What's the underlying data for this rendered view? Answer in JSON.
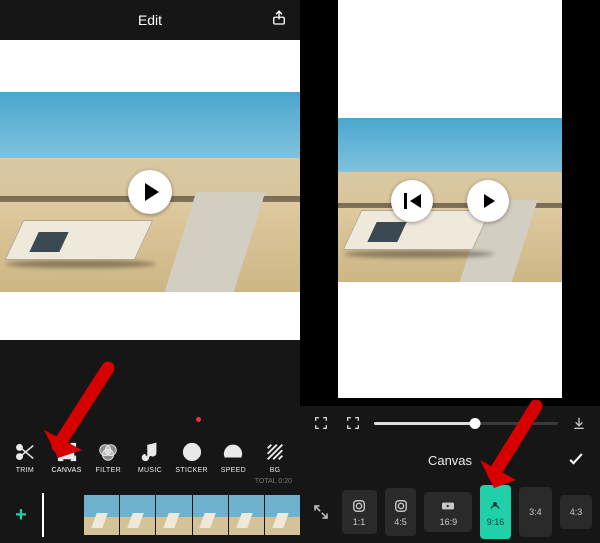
{
  "left": {
    "header": {
      "title": "Edit"
    },
    "tools": [
      {
        "id": "trim",
        "label": "TRIM"
      },
      {
        "id": "canvas",
        "label": "CANVAS"
      },
      {
        "id": "filter",
        "label": "FILTER"
      },
      {
        "id": "music",
        "label": "MUSIC"
      },
      {
        "id": "sticker",
        "label": "STICKER",
        "dot": true
      },
      {
        "id": "speed",
        "label": "SPEED"
      },
      {
        "id": "bg",
        "label": "BG"
      }
    ],
    "timeline_total": "TOTAL 0:20",
    "plus": "+"
  },
  "right": {
    "panel_title": "Canvas",
    "scrub_progress_pct": 55,
    "ratios": [
      {
        "id": "1_1",
        "label": "1:1"
      },
      {
        "id": "4_5",
        "label": "4:5"
      },
      {
        "id": "16_9",
        "label": "16:9"
      },
      {
        "id": "9_16",
        "label": "9:16",
        "selected": true
      },
      {
        "id": "3_4",
        "label": "3:4"
      },
      {
        "id": "4_3",
        "label": "4:3"
      }
    ]
  },
  "colors": {
    "accent": "#21d0a8",
    "arrow": "#d60000"
  }
}
